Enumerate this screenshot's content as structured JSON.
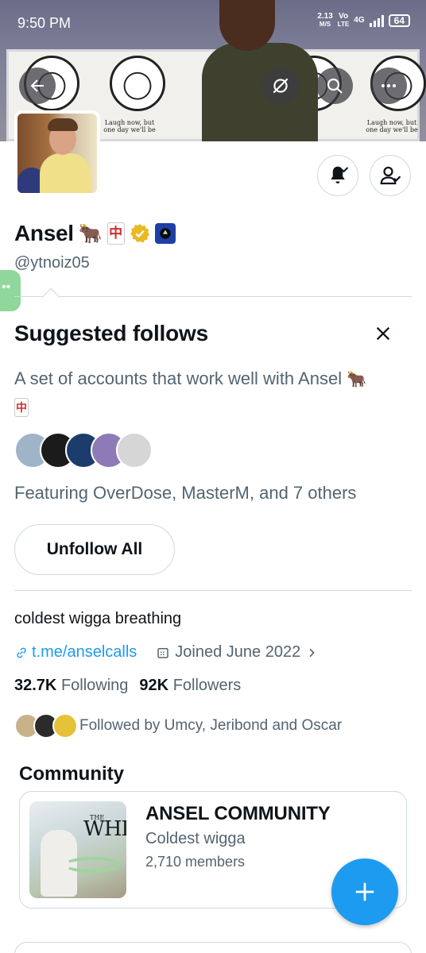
{
  "status_bar": {
    "time": "9:50 PM",
    "speed_value": "2.13",
    "speed_unit": "M/S",
    "volte_top": "Vo",
    "volte_bottom": "LTE",
    "network": "4G",
    "battery": "64"
  },
  "banner": {
    "caption_left": "Laugh now, but one day we'll be",
    "caption_right": "Laugh now, but one day we'll be"
  },
  "profile": {
    "name": "Ansel",
    "name_emoji": "🐂",
    "mahjong_glyph": "中",
    "handle": "@ytnoiz05",
    "bio": "coldest wigga breathing",
    "link": "t.me/anselcalls",
    "joined": "Joined June 2022",
    "following_count": "32.7K",
    "following_label": "Following",
    "followers_count": "92K",
    "followers_label": "Followers",
    "followed_by": "Followed by Umcy, Jeribond and Oscar"
  },
  "suggested": {
    "title": "Suggested follows",
    "description": "A set of accounts that work well with Ansel",
    "featuring": "Featuring OverDose, MasterM, and 7 others",
    "unfollow_label": "Unfollow All",
    "avatar_colors": [
      "#9fb4c7",
      "#1b1b1b",
      "#1c3d6b",
      "#8f7ab8",
      "#d6d6d6"
    ]
  },
  "community": {
    "section_title": "Community",
    "name": "ANSEL COMMUNITY",
    "subtitle": "Coldest wigga",
    "members": "2,710 members",
    "image_text_small": "THE",
    "image_text_large": "WHI"
  },
  "colors": {
    "accent": "#1d9bf0",
    "verified_gold": "#e8b923",
    "secondary_text": "#536471"
  },
  "icons": [
    "back-arrow-icon",
    "grok-icon",
    "search-icon",
    "more-icon",
    "bell-check-icon",
    "person-check-icon",
    "close-icon",
    "link-icon",
    "calendar-icon",
    "chevron-right-icon",
    "plus-icon"
  ]
}
